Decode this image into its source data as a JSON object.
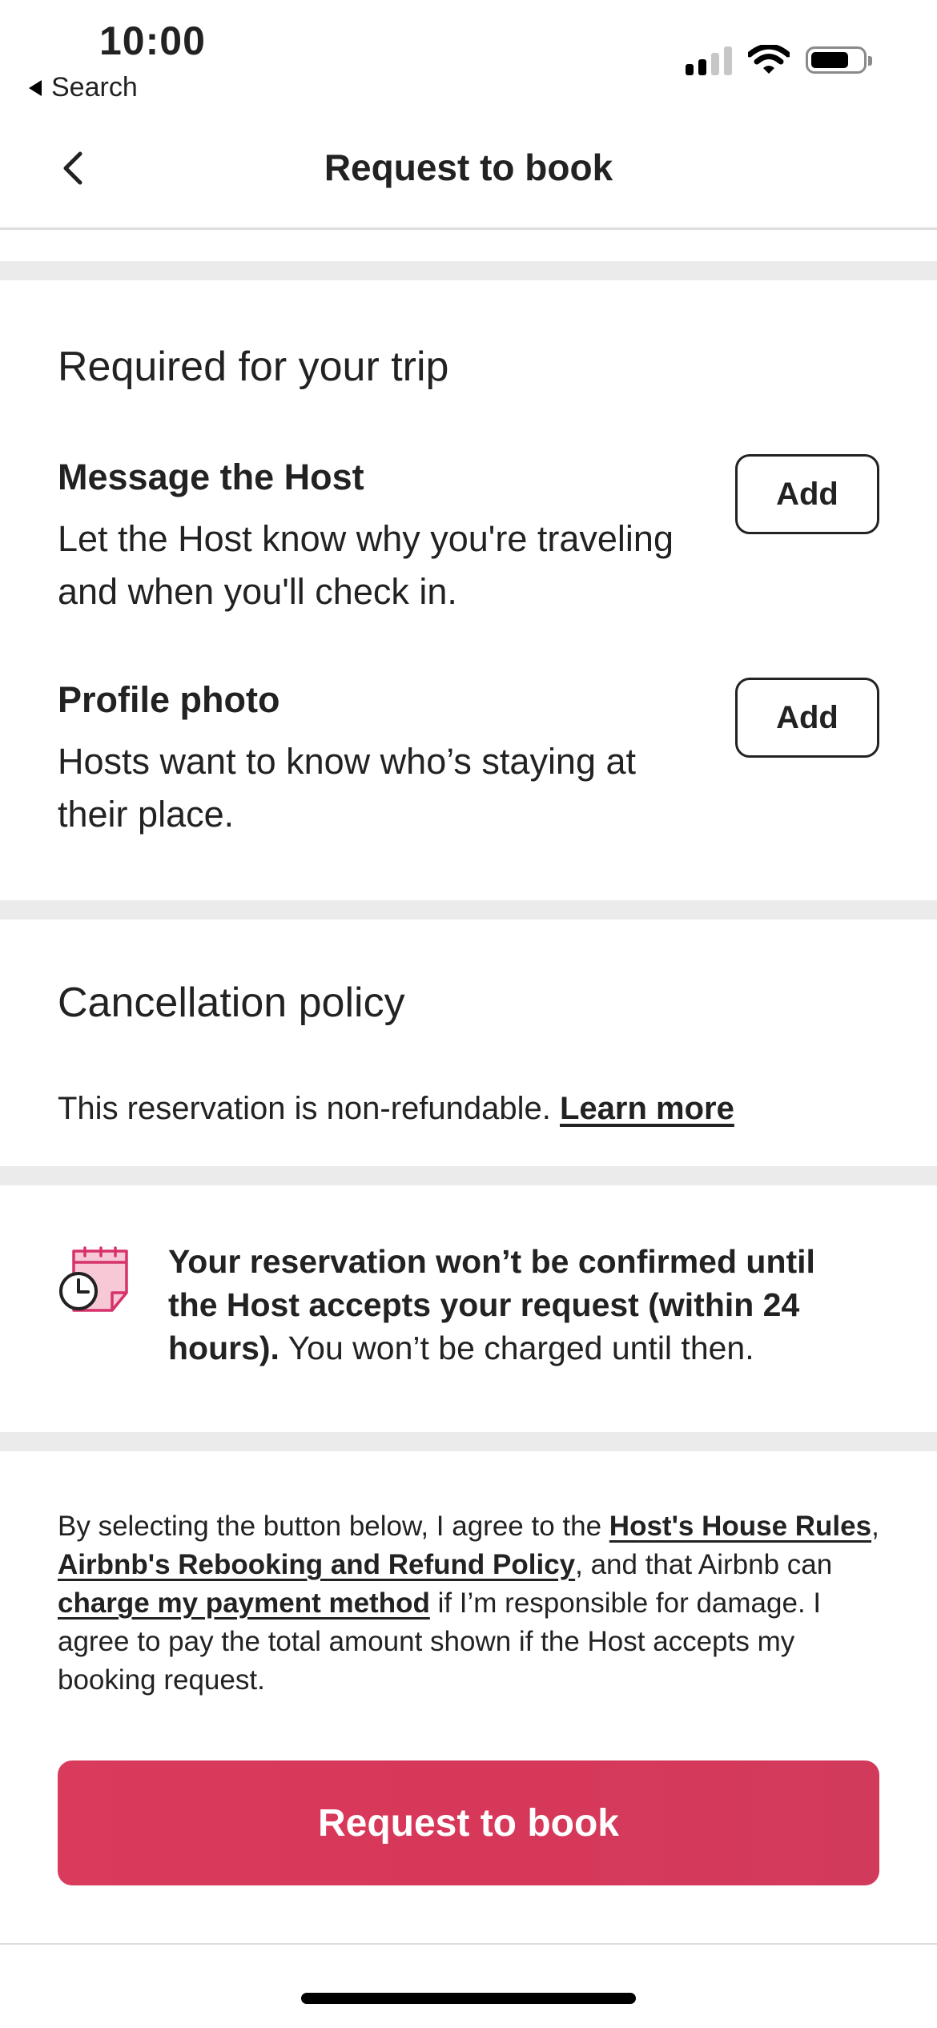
{
  "status_bar": {
    "time": "10:00",
    "back_app_label": "Search"
  },
  "header": {
    "title": "Request to book"
  },
  "required_section": {
    "title": "Required for your trip",
    "items": [
      {
        "title": "Message the Host",
        "description": "Let the Host know why you're traveling and when you'll check in.",
        "button": "Add"
      },
      {
        "title": "Profile photo",
        "description": "Hosts want to know who’s staying at their place.",
        "button": "Add"
      }
    ]
  },
  "cancellation": {
    "title": "Cancellation policy",
    "text": "This reservation is non-refundable. ",
    "link": "Learn more"
  },
  "notice": {
    "icon": "calendar-clock-icon",
    "bold_text": "Your reservation won’t be confirmed until the Host accepts your request (within 24 hours).",
    "text": "  You won’t be charged until then."
  },
  "legal": {
    "part1": "By selecting the button below, I agree to the ",
    "link1": "Host's House Rules",
    "part2": ", ",
    "link2": "Airbnb's Rebooking and Refund Policy",
    "part3": ", and that Airbnb can ",
    "link3": "charge my payment method",
    "part4": " if I’m responsible for damage. I agree to pay the total amount shown if the Host accepts my booking request."
  },
  "cta": {
    "label": "Request to book"
  },
  "colors": {
    "brand": "#d93b5c",
    "text": "#222222",
    "divider": "#ebebeb",
    "icon_accent": "#d6326b"
  }
}
